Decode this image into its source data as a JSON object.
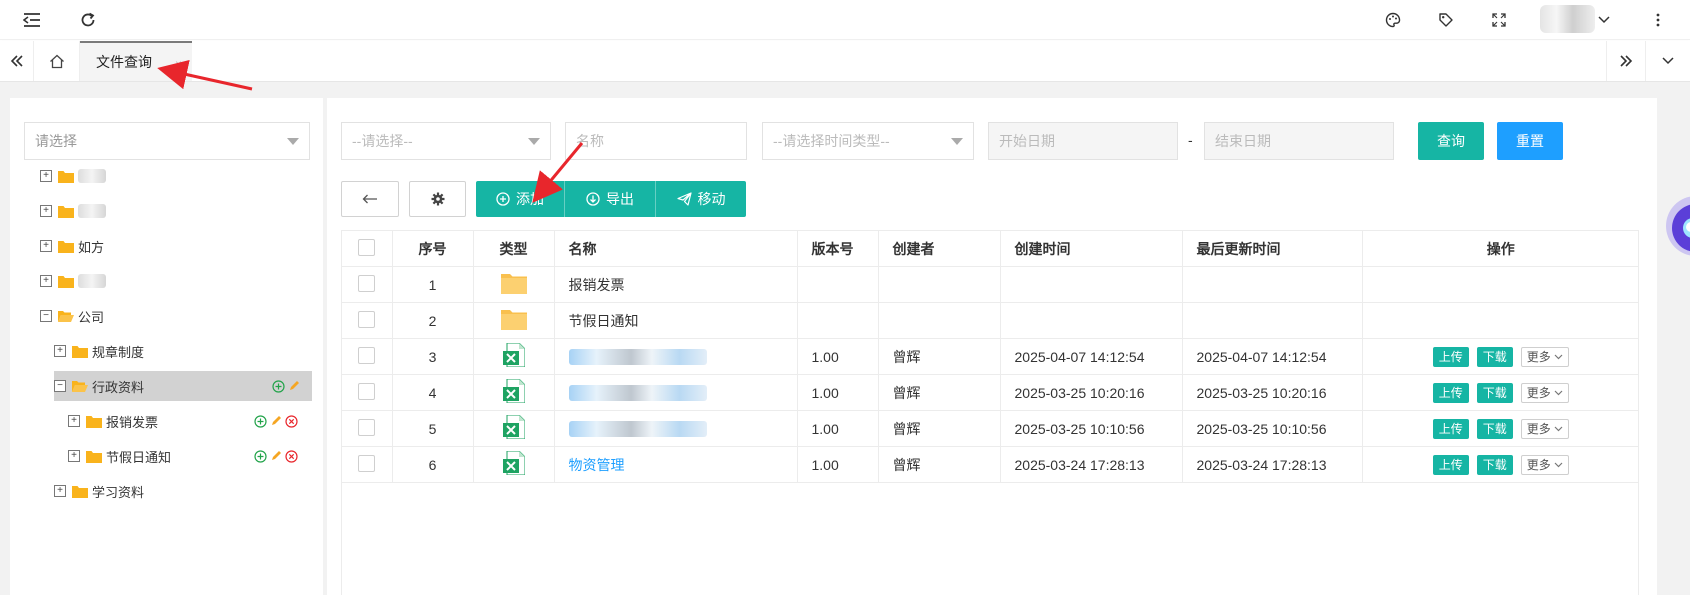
{
  "colors": {
    "primary_teal": "#16b5a4",
    "reset_blue": "#1e9fff",
    "link_blue": "#1e9fff",
    "folder_yellow": "#f9b31c",
    "excel_green": "#1ea362",
    "annotation_red": "#e8262c"
  },
  "topbar": {
    "icons": [
      "menu-fold-icon",
      "refresh-icon",
      "palette-icon",
      "tag-icon",
      "fullscreen-icon",
      "chevron-down-icon",
      "more-vertical-icon"
    ]
  },
  "tabbar": {
    "active_tab": {
      "label": "文件查询",
      "close": "×"
    },
    "icons": [
      "double-chevron-left-icon",
      "home-icon",
      "double-chevron-right-icon",
      "chevron-down-icon"
    ]
  },
  "tree": {
    "select_placeholder": "请选择",
    "nodes": [
      {
        "label": "",
        "blurred": true,
        "toggle": "+"
      },
      {
        "label": "",
        "blurred": true,
        "toggle": "+"
      },
      {
        "label": "如方",
        "toggle": "+"
      },
      {
        "label": "",
        "blurred": true,
        "toggle": "+"
      },
      {
        "label": "公司",
        "toggle": "−"
      },
      {
        "label": "规章制度",
        "toggle": "+"
      },
      {
        "label": "行政资料",
        "toggle": "−",
        "selected": true
      },
      {
        "label": "报销发票",
        "toggle": "+"
      },
      {
        "label": "节假日通知",
        "toggle": "+"
      },
      {
        "label": "学习资料",
        "toggle": "+"
      }
    ]
  },
  "filters": {
    "select_placeholder": "--请选择--",
    "name_placeholder": "名称",
    "time_type_placeholder": "--请选择时间类型--",
    "start_date_placeholder": "开始日期",
    "date_separator": "-",
    "end_date_placeholder": "结束日期",
    "search_label": "查询",
    "reset_label": "重置"
  },
  "toolbar": {
    "add_label": "添加",
    "export_label": "导出",
    "move_label": "移动"
  },
  "table": {
    "headers": [
      "序号",
      "类型",
      "名称",
      "版本号",
      "创建者",
      "创建时间",
      "最后更新时间",
      "操作"
    ],
    "rows": [
      {
        "index": "1",
        "type": "folder",
        "name": "报销发票",
        "version": "",
        "creator": "",
        "created": "",
        "updated": ""
      },
      {
        "index": "2",
        "type": "folder",
        "name": "节假日通知",
        "version": "",
        "creator": "",
        "created": "",
        "updated": ""
      },
      {
        "index": "3",
        "type": "excel",
        "name": "",
        "blurred": true,
        "version": "1.00",
        "creator": "曾辉",
        "created": "2025-04-07 14:12:54",
        "updated": "2025-04-07 14:12:54"
      },
      {
        "index": "4",
        "type": "excel",
        "name": "",
        "blurred": true,
        "version": "1.00",
        "creator": "曾辉",
        "created": "2025-03-25 10:20:16",
        "updated": "2025-03-25 10:20:16"
      },
      {
        "index": "5",
        "type": "excel",
        "name": "",
        "blurred": true,
        "version": "1.00",
        "creator": "曾辉",
        "created": "2025-03-25 10:10:56",
        "updated": "2025-03-25 10:10:56"
      },
      {
        "index": "6",
        "type": "excel",
        "name": "物资管理",
        "version": "1.00",
        "creator": "曾辉",
        "created": "2025-03-24 17:28:13",
        "updated": "2025-03-24 17:28:13"
      }
    ],
    "actions": {
      "upload": "上传",
      "download": "下载",
      "more": "更多"
    }
  }
}
